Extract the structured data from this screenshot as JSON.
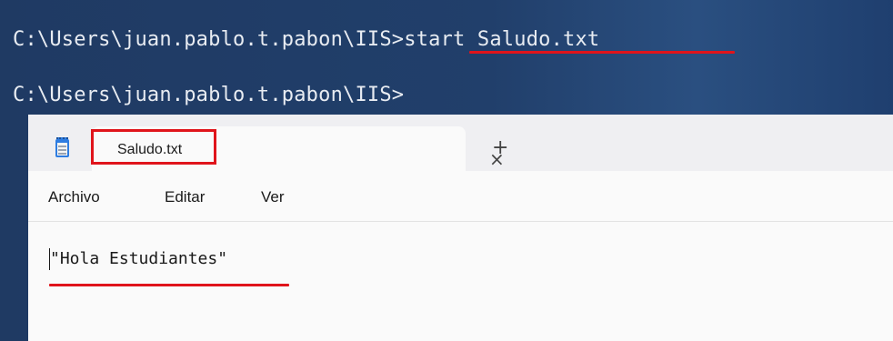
{
  "terminal": {
    "line1_prompt": "C:\\Users\\juan.pablo.t.pabon\\IIS>",
    "line1_command": "start Saludo.txt",
    "line2_prompt": "C:\\Users\\juan.pablo.t.pabon\\IIS>"
  },
  "notepad": {
    "app_icon": "notepad-icon",
    "tab": {
      "title": "Saludo.txt",
      "close_glyph": "×"
    },
    "new_tab_glyph": "+",
    "menu": [
      "Archivo",
      "Editar",
      "Ver"
    ],
    "content": "\"Hola Estudiantes\""
  },
  "colors": {
    "terminal_bg": "#213f6b",
    "annotation_red": "#e0141b",
    "notepad_bg": "#fafafa"
  }
}
